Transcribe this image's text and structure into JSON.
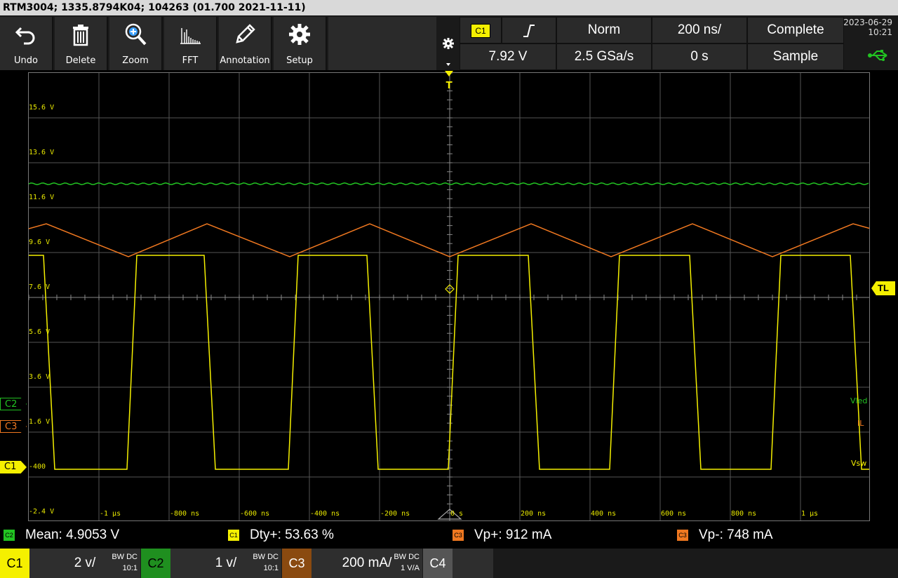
{
  "window": {
    "title": "RTM3004; 1335.8794K04; 104263 (01.700 2021-11-11)"
  },
  "toolbar": {
    "buttons": [
      {
        "label": "Undo",
        "icon": "undo-icon"
      },
      {
        "label": "Delete",
        "icon": "trash-icon"
      },
      {
        "label": "Zoom",
        "icon": "zoom-icon"
      },
      {
        "label": "FFT",
        "icon": "fft-icon"
      },
      {
        "label": "Annotation",
        "icon": "pencil-icon"
      },
      {
        "label": "Setup",
        "icon": "gear-icon"
      }
    ]
  },
  "trigger": {
    "source": "C1",
    "slope_icon": "rising-edge-icon",
    "mode": "Norm",
    "timebase": "200 ns/",
    "status": "Complete",
    "level": "7.92 V",
    "sample_rate": "2.5 GSa/s",
    "position": "0 s",
    "acquisition": "Sample"
  },
  "datetime": {
    "date": "2023-06-29",
    "time": "10:21"
  },
  "y_ticks": [
    "15.6 V",
    "13.6 V",
    "11.6 V",
    "9.6 V",
    "7.6 V",
    "5.6 V",
    "3.6 V",
    "1.6 V",
    "-400",
    "-2.4 V"
  ],
  "x_ticks": [
    "-1 µs",
    "-800 ns",
    "-600 ns",
    "-400 ns",
    "-200 ns",
    "0 s",
    "200 ns",
    "400 ns",
    "600 ns",
    "800 ns",
    "1 µs"
  ],
  "markers": {
    "trigger_top": "T",
    "trigger_level": "TL"
  },
  "channel_tags": [
    {
      "id": "C2",
      "color": "#22c322"
    },
    {
      "id": "C3",
      "color": "#f07820"
    },
    {
      "id": "C1",
      "color": "#f5f000"
    }
  ],
  "trace_labels": {
    "c2": "Vled",
    "c3": "IL",
    "c1": "Vsw"
  },
  "colors": {
    "c1": "#f5f000",
    "c2": "#22c322",
    "c3": "#f07820",
    "grid": "#555555"
  },
  "measurements": [
    {
      "ch": "C2",
      "text": "Mean: 4.9053 V",
      "color": "#22c322"
    },
    {
      "ch": "C1",
      "text": "Dty+: 53.63 %",
      "color": "#f5f000"
    },
    {
      "ch": "C3",
      "text": "Vp+: 912 mA",
      "color": "#f07820"
    },
    {
      "ch": "C3",
      "text": "Vp-: 748 mA",
      "color": "#f07820"
    }
  ],
  "channels_bottom": [
    {
      "id": "C1",
      "scale": "2 v/",
      "bw": "BW DC",
      "probe": "10:1",
      "color": "#f5f000"
    },
    {
      "id": "C2",
      "scale": "1 v/",
      "bw": "BW DC",
      "probe": "10:1",
      "color": "#1f8f1f"
    },
    {
      "id": "C3",
      "scale": "200 mA/",
      "bw": "BW DC",
      "probe": "1 V/A",
      "color": "#8a4a10"
    },
    {
      "id": "C4",
      "scale": "",
      "bw": "",
      "probe": "",
      "color": "#555555"
    }
  ],
  "chart_data": {
    "type": "line",
    "title": "",
    "xlabel": "",
    "ylabel": "",
    "x_range_ns": [
      -1200,
      1200
    ],
    "grid": true,
    "series": [
      {
        "name": "Vled",
        "unit": "V",
        "description": "flat ~12.0 V"
      },
      {
        "name": "IL",
        "description": "triangle, period ~920 ns, peaks 912 mA / valleys 748 mA"
      },
      {
        "name": "Vsw",
        "description": "square wave ~9.0 V / ~-0.5 V, period ~920 ns, duty 53.63 %",
        "rising_edges_ns": [
          -916,
          -456,
          0,
          460,
          920
        ],
        "falling_edges_ns": [
          -1150,
          -692,
          -228,
          232,
          692,
          1150
        ]
      }
    ]
  }
}
